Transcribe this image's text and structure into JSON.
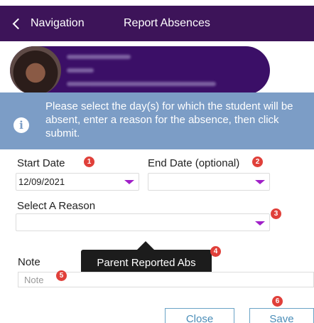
{
  "header": {
    "back_label": "Navigation",
    "title": "Report Absences"
  },
  "info": {
    "message": "Please select the day(s) for which the student will be absent, enter a reason for the absence, then click submit."
  },
  "form": {
    "start_date": {
      "label": "Start Date",
      "value": "12/09/2021",
      "step": "1"
    },
    "end_date": {
      "label": "End Date (optional)",
      "value": "",
      "step": "2"
    },
    "reason": {
      "label": "Select A Reason",
      "value": "",
      "step": "3"
    },
    "reason_option": {
      "text": "Parent Reported Abs",
      "step": "4"
    },
    "note": {
      "label": "Note",
      "placeholder": "Note",
      "step": "5"
    }
  },
  "actions": {
    "close_label": "Close",
    "save_label": "Save",
    "save_step": "6"
  },
  "colors": {
    "header_bg": "#3d1459",
    "banner_bg": "#7c9dc6",
    "accent": "#a020c8",
    "badge": "#e0403a",
    "button_text": "#4a8db8"
  }
}
